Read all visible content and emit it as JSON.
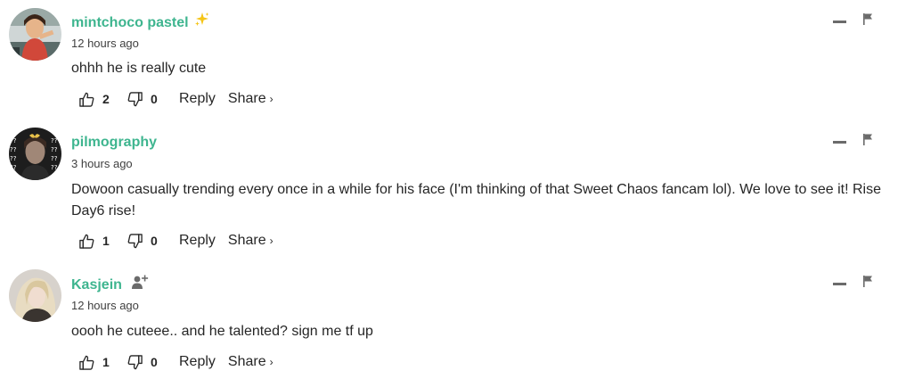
{
  "comments": [
    {
      "username": "mintchoco pastel",
      "username_emoji": "✨",
      "time": "12 hours ago",
      "text": "ohhh he is really cute",
      "likes": "2",
      "dislikes": "0",
      "reply_label": "Reply",
      "share_label": "Share",
      "share_chevron": "›"
    },
    {
      "username": "pilmography",
      "time": "3 hours ago",
      "text": "Dowoon casually trending every once in a while for his face (I'm thinking of that Sweet Chaos fancam lol). We love to see it! Rise Day6 rise!",
      "likes": "1",
      "dislikes": "0",
      "reply_label": "Reply",
      "share_label": "Share",
      "share_chevron": "›",
      "avatar_text": "??"
    },
    {
      "username": "Kasjein",
      "time": "12 hours ago",
      "text": "oooh he cuteee.. and he talented? sign me tf up",
      "likes": "1",
      "dislikes": "0",
      "reply_label": "Reply",
      "share_label": "Share",
      "share_chevron": "›"
    }
  ],
  "colors": {
    "username": "#3eb58f",
    "text": "#262626",
    "icon": "#6b6b6b",
    "sparkle": "#f5c518"
  },
  "icons": {
    "like": "thumbs-up-icon",
    "dislike": "thumbs-down-icon",
    "minimize": "minimize-icon",
    "flag": "flag-icon",
    "follow": "add-user-icon",
    "sparkle": "sparkles-icon"
  }
}
